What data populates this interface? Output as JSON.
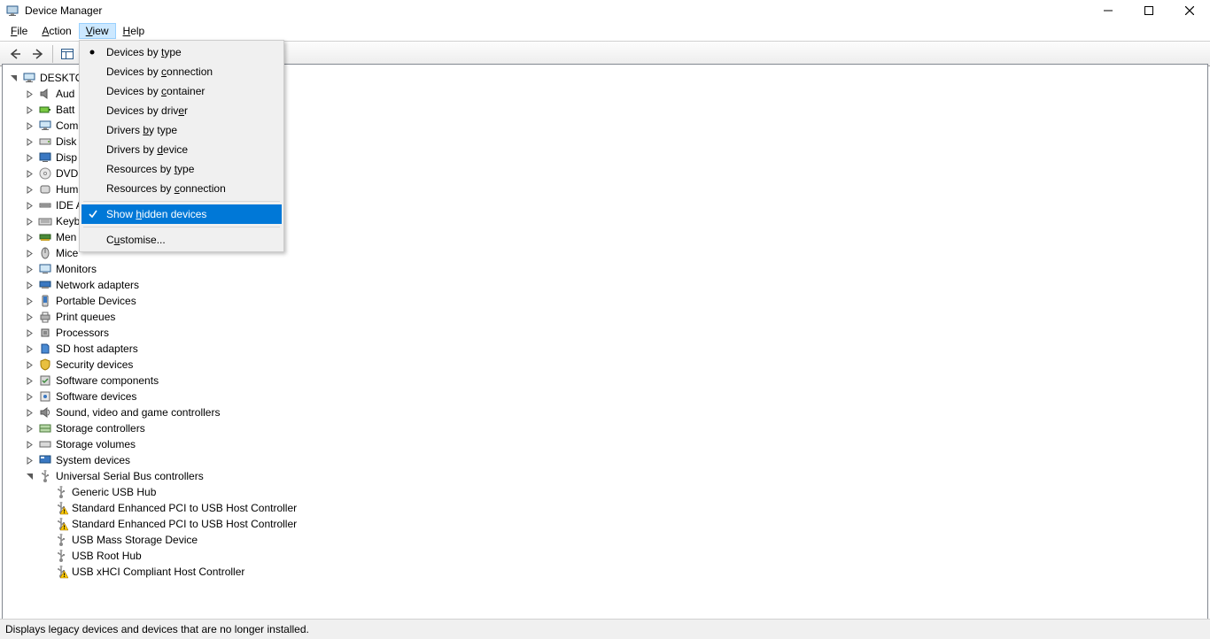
{
  "title": "Device Manager",
  "menubar": {
    "file": "File",
    "action": "Action",
    "view": "View",
    "help": "Help"
  },
  "view_menu": {
    "items": [
      {
        "label": "Devices by type",
        "mark": "dot"
      },
      {
        "label": "Devices by connection"
      },
      {
        "label": "Devices by container"
      },
      {
        "label": "Devices by driver"
      },
      {
        "label": "Drivers by type"
      },
      {
        "label": "Drivers by device"
      },
      {
        "label": "Resources by type"
      },
      {
        "label": "Resources by connection"
      },
      {
        "sep": true
      },
      {
        "label": "Show hidden devices",
        "mark": "check",
        "selected": true
      },
      {
        "sep": true
      },
      {
        "label": "Customise..."
      }
    ],
    "underline_indices": [
      11,
      11,
      11,
      15,
      8,
      11,
      13,
      13,
      null,
      5,
      null,
      1
    ]
  },
  "tree": {
    "root": {
      "label": "DESKTO",
      "icon": "computer",
      "expanded": true
    },
    "categories": [
      {
        "label": "Aud",
        "icon": "audio"
      },
      {
        "label": "Batt",
        "icon": "battery"
      },
      {
        "label": "Com",
        "icon": "computer"
      },
      {
        "label": "Disk",
        "icon": "disk"
      },
      {
        "label": "Disp",
        "icon": "display"
      },
      {
        "label": "DVD",
        "icon": "dvd"
      },
      {
        "label": "Hum",
        "icon": "hid"
      },
      {
        "label": "IDE A",
        "icon": "ide"
      },
      {
        "label": "Keyb",
        "icon": "keyboard"
      },
      {
        "label": "Men",
        "icon": "memory"
      },
      {
        "label": "Mice",
        "icon": "mouse"
      },
      {
        "label": "Monitors",
        "icon": "monitor"
      },
      {
        "label": "Network adapters",
        "icon": "network"
      },
      {
        "label": "Portable Devices",
        "icon": "portable"
      },
      {
        "label": "Print queues",
        "icon": "printer"
      },
      {
        "label": "Processors",
        "icon": "cpu"
      },
      {
        "label": "SD host adapters",
        "icon": "sd"
      },
      {
        "label": "Security devices",
        "icon": "security"
      },
      {
        "label": "Software components",
        "icon": "swcomp"
      },
      {
        "label": "Software devices",
        "icon": "swdev"
      },
      {
        "label": "Sound, video and game controllers",
        "icon": "sound"
      },
      {
        "label": "Storage controllers",
        "icon": "storage"
      },
      {
        "label": "Storage volumes",
        "icon": "volume"
      },
      {
        "label": "System devices",
        "icon": "system"
      },
      {
        "label": "Universal Serial Bus controllers",
        "icon": "usb",
        "expanded": true,
        "children": [
          {
            "label": "Generic USB Hub",
            "icon": "usb"
          },
          {
            "label": "Standard Enhanced PCI to USB Host Controller",
            "icon": "usb",
            "warn": true
          },
          {
            "label": "Standard Enhanced PCI to USB Host Controller",
            "icon": "usb",
            "warn": true
          },
          {
            "label": "USB Mass Storage Device",
            "icon": "usb"
          },
          {
            "label": "USB Root Hub",
            "icon": "usb"
          },
          {
            "label": "USB xHCI Compliant Host Controller",
            "icon": "usb",
            "warn": true
          }
        ]
      }
    ]
  },
  "statusbar": "Displays legacy devices and devices that are no longer installed."
}
